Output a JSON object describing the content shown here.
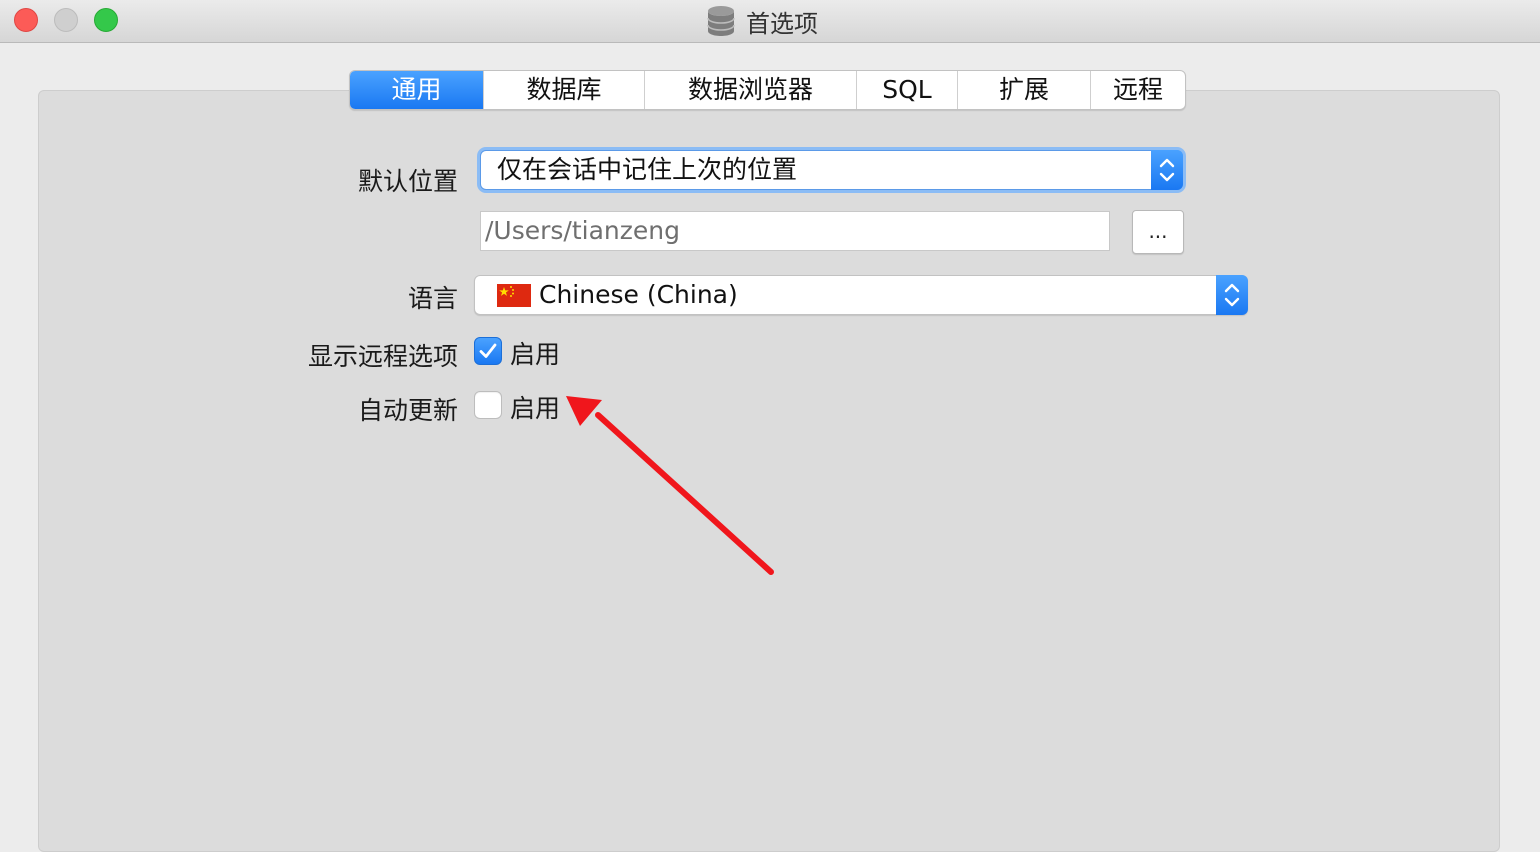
{
  "window": {
    "title": "首选项",
    "icon": "database-icon"
  },
  "tabs": [
    {
      "label": "通用",
      "active": true
    },
    {
      "label": "数据库",
      "active": false
    },
    {
      "label": "数据浏览器",
      "active": false
    },
    {
      "label": "SQL",
      "active": false
    },
    {
      "label": "扩展",
      "active": false
    },
    {
      "label": "远程",
      "active": false
    }
  ],
  "general": {
    "default_location": {
      "label": "默认位置",
      "selected": "仅在会话中记住上次的位置",
      "path": "/Users/tianzeng",
      "browse_label": "..."
    },
    "language": {
      "label": "语言",
      "selected": "Chinese (China)",
      "flag_icon": "china-flag-icon"
    },
    "show_remote": {
      "label": "显示远程选项",
      "checkbox_label": "启用",
      "checked": true
    },
    "auto_update": {
      "label": "自动更新",
      "checkbox_label": "启用",
      "checked": false
    }
  },
  "colors": {
    "accent": "#1a78f2",
    "annotation_arrow": "#f0161c",
    "close": "#fc5b57",
    "zoom": "#34c84a"
  }
}
